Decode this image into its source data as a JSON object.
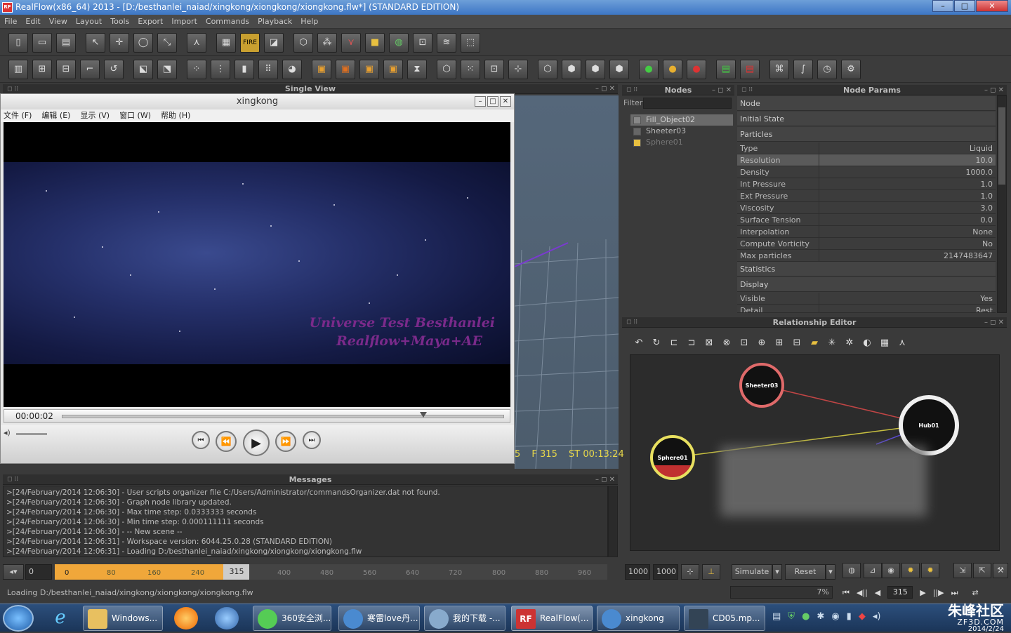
{
  "window": {
    "title": "RealFlow(x86_64) 2013 - [D:/besthanlei_naiad/xingkong/xiongkong/xiongkong.flw*] (STANDARD EDITION)",
    "icon": "RF",
    "controls": [
      "–",
      "□",
      "✕"
    ]
  },
  "menu": [
    "File",
    "Edit",
    "View",
    "Layout",
    "Tools",
    "Export",
    "Import",
    "Commands",
    "Playback",
    "Help"
  ],
  "single_view": {
    "title": "Single View"
  },
  "player": {
    "title": "xingkong",
    "menu": [
      "文件 (F)",
      "编辑 (E)",
      "显示 (V)",
      "窗口 (W)",
      "帮助 (H)"
    ],
    "video_text": [
      "Universe Test Besthanlei",
      "Realflow+Maya+AE"
    ],
    "time": "00:00:02",
    "progress": 0.81
  },
  "viewport": {
    "frame": "5",
    "frame_label": "F 315",
    "st": "ST 00:13:24"
  },
  "nodes": {
    "title": "Nodes",
    "filter_label": "Filter",
    "items": [
      "Fill_Object02",
      "Sheeter03",
      "Sphere01"
    ]
  },
  "node_params": {
    "title": "Node Params",
    "sections_top": [
      "Node",
      "Initial State",
      "Particles"
    ],
    "rows": [
      {
        "k": "Type",
        "v": "Liquid"
      },
      {
        "k": "Resolution",
        "v": "10.0"
      },
      {
        "k": "Density",
        "v": "1000.0"
      },
      {
        "k": "Int Pressure",
        "v": "1.0"
      },
      {
        "k": "Ext Pressure",
        "v": "1.0"
      },
      {
        "k": "Viscosity",
        "v": "3.0"
      },
      {
        "k": "Surface Tension",
        "v": "0.0"
      },
      {
        "k": "Interpolation",
        "v": "None"
      },
      {
        "k": "Compute Vorticity",
        "v": "No"
      },
      {
        "k": "Max particles",
        "v": "2147483647"
      }
    ],
    "statistics": "Statistics",
    "display": "Display",
    "rows2": [
      {
        "k": "Visible",
        "v": "Yes"
      },
      {
        "k": "Detail",
        "v": "Rest"
      }
    ]
  },
  "relationship": {
    "title": "Relationship Editor",
    "nodes": [
      "Sheeter03",
      "Hub01",
      "Sphere01"
    ]
  },
  "messages": {
    "title": "Messages",
    "lines": [
      ">[24/February/2014 12:06:30] - User scripts organizer file C:/Users/Administrator/commandsOrganizer.dat not found.",
      ">[24/February/2014 12:06:30] - Graph node library updated.",
      ">[24/February/2014 12:06:30] - Max time step: 0.0333333 seconds",
      ">[24/February/2014 12:06:30] - Min time step: 0.000111111 seconds",
      ">[24/February/2014 12:06:30] - -- New scene --",
      ">[24/February/2014 12:06:31] - Workspace version: 6044.25.0.28 (STANDARD EDITION)",
      ">[24/February/2014 12:06:31] -  Loading D:/besthanlei_naiad/xingkong/xiongkong/xiongkong.flw"
    ]
  },
  "timeline": {
    "start": "0",
    "ruler_start": "0",
    "ticks_orange": [
      "80",
      "160",
      "240"
    ],
    "end_marker": "315",
    "ticks_gray": [
      "400",
      "480",
      "560",
      "640",
      "720",
      "800",
      "880",
      "960"
    ],
    "f1": "1000",
    "f2": "1000",
    "simulate": "Simulate",
    "reset": "Reset",
    "percent": "7%",
    "current": "315"
  },
  "status": "Loading D:/besthanlei_naiad/xingkong/xiongkong/xiongkong.flw",
  "taskbar": {
    "items": [
      "Windows...",
      "360安全浏...",
      "寒雷love丹...",
      "我的下载 -...",
      "RealFlow(...",
      "xingkong",
      "CD05.mp..."
    ],
    "watermark": "朱峰社区",
    "watermark2": "ZF3D.COM",
    "date": "2014/2/24"
  }
}
